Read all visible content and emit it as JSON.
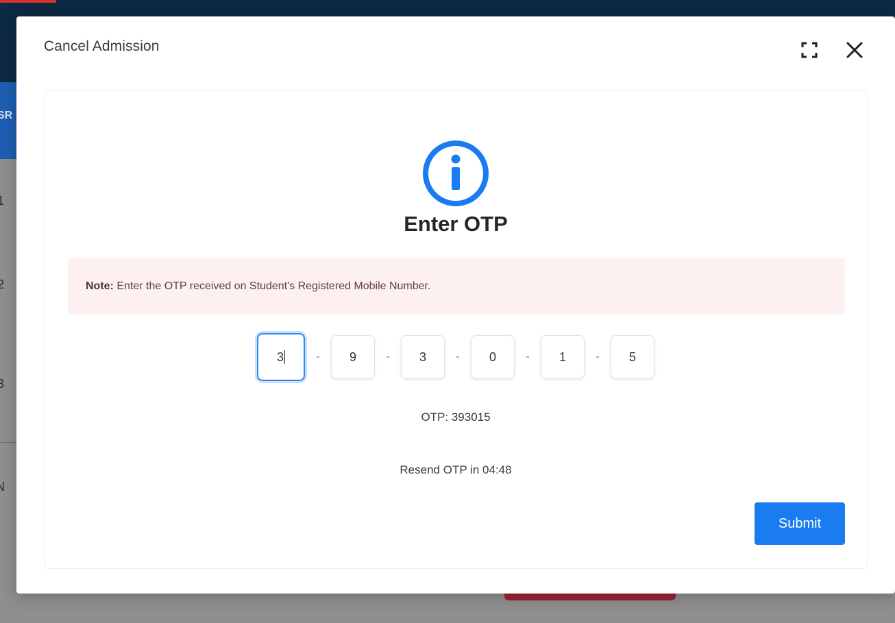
{
  "background": {
    "srn_label": "SR",
    "rows": [
      "1",
      "2",
      "3"
    ],
    "partial_label": "N"
  },
  "modal": {
    "title": "Cancel Admission",
    "expand_icon": "expand-icon",
    "close_icon": "close-icon",
    "info_icon": "info-circle-icon",
    "heading": "Enter OTP",
    "note": {
      "label": "Note:",
      "text": " Enter the OTP received on Student's Registered Mobile Number."
    },
    "otp_digits": [
      "3",
      "9",
      "3",
      "0",
      "1",
      "5"
    ],
    "otp_separator": "-",
    "otp_hint": "OTP: 393015",
    "resend_text": "Resend OTP in 04:48",
    "submit_label": "Submit"
  },
  "colors": {
    "accent": "#1a7cf0",
    "note_background": "#fdf0f0",
    "topbar": "#0d2a44"
  }
}
